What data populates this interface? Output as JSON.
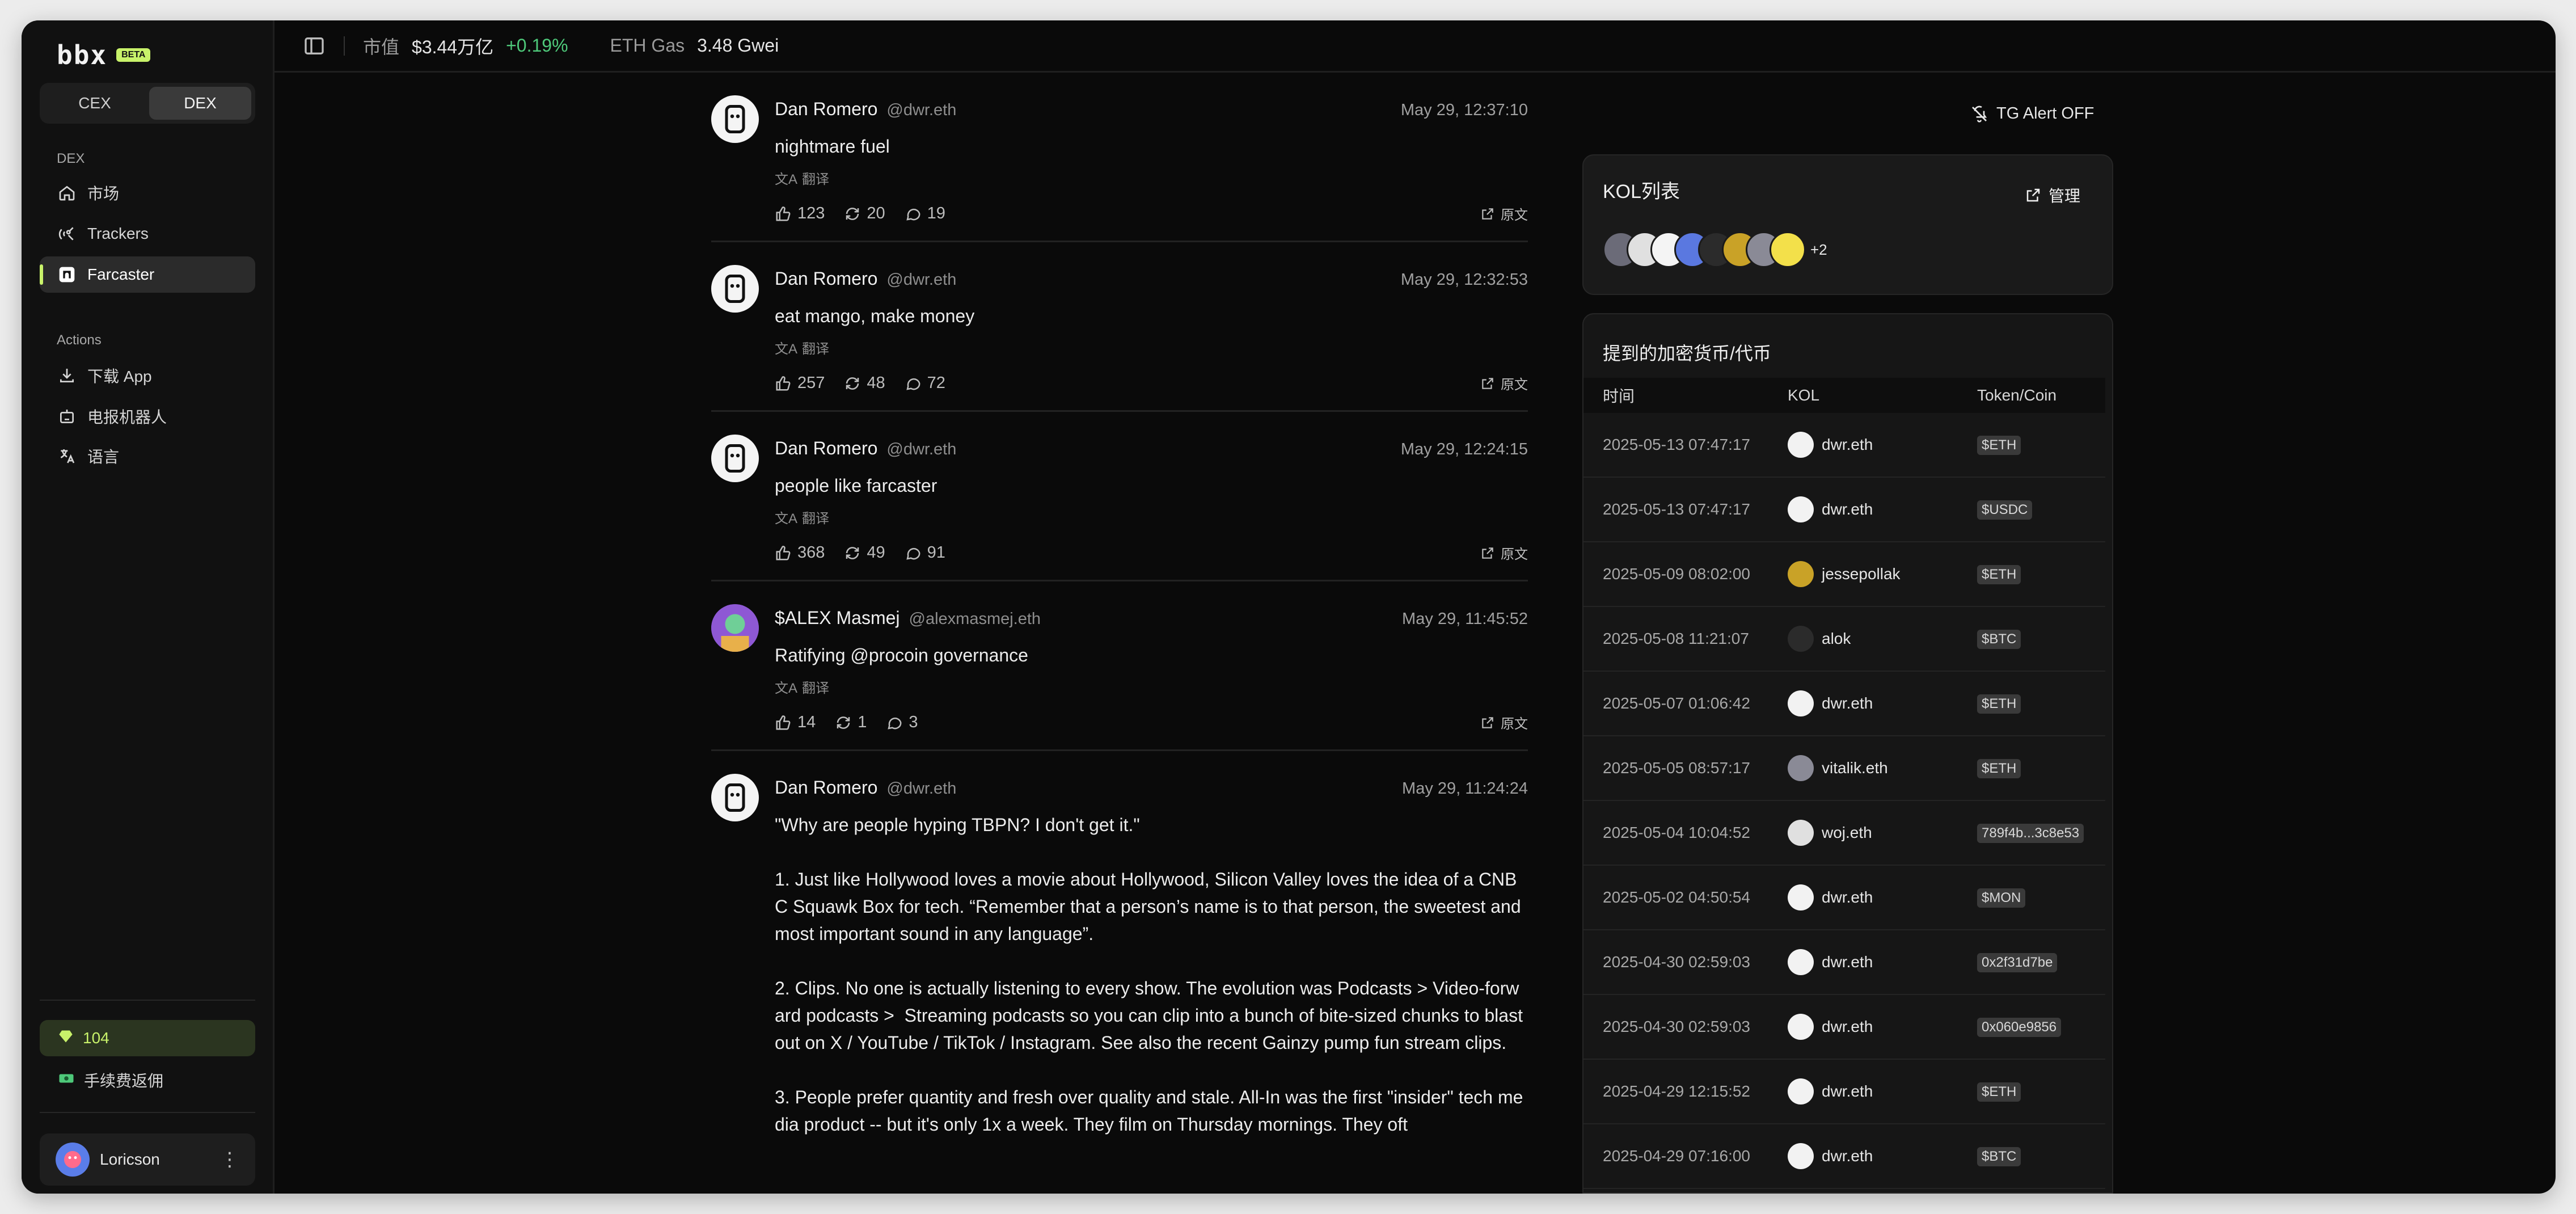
{
  "brand": {
    "logo": "bbx",
    "badge": "BETA"
  },
  "segment": {
    "cex": "CEX",
    "dex": "DEX"
  },
  "sidebar": {
    "dex_label": "DEX",
    "items": [
      {
        "label": "市场",
        "icon": "home-icon"
      },
      {
        "label": "Trackers",
        "icon": "satellite-icon"
      },
      {
        "label": "Farcaster",
        "icon": "farcaster-icon"
      }
    ],
    "actions_label": "Actions",
    "actions": [
      {
        "label": "下载 App",
        "icon": "download-icon"
      },
      {
        "label": "电报机器人",
        "icon": "bot-icon"
      },
      {
        "label": "语言",
        "icon": "translate-icon"
      }
    ],
    "points": "104",
    "rebate": "手续费返佣",
    "user": "Loricson"
  },
  "topbar": {
    "mcap_label": "市值",
    "mcap_value": "$3.44万亿",
    "mcap_change": "+0.19%",
    "gas_label": "ETH Gas",
    "gas_value": "3.48 Gwei"
  },
  "feed": {
    "translate": "翻译",
    "source": "原文",
    "posts": [
      {
        "name": "Dan Romero",
        "handle": "@dwr.eth",
        "time": "May 29, 12:37:10",
        "text": "nightmare fuel",
        "likes": "123",
        "recasts": "20",
        "replies": "19"
      },
      {
        "name": "Dan Romero",
        "handle": "@dwr.eth",
        "time": "May 29, 12:32:53",
        "text": "eat mango, make money",
        "likes": "257",
        "recasts": "48",
        "replies": "72"
      },
      {
        "name": "Dan Romero",
        "handle": "@dwr.eth",
        "time": "May 29, 12:24:15",
        "text": "people like farcaster",
        "likes": "368",
        "recasts": "49",
        "replies": "91"
      },
      {
        "name": "$ALEX Masmej",
        "handle": "@alexmasmej.eth",
        "time": "May 29, 11:45:52",
        "text": "Ratifying @procoin governance",
        "likes": "14",
        "recasts": "1",
        "replies": "3"
      },
      {
        "name": "Dan Romero",
        "handle": "@dwr.eth",
        "time": "May 29, 11:24:24",
        "text": "\"Why are people hyping TBPN? I don't get it.\"\n\n1. Just like Hollywood loves a movie about Hollywood, Silicon Valley loves the idea of a CNBC Squawk Box for tech. “Remember that a person’s name is to that person, the sweetest and most important sound in any language”.\n\n2. Clips. No one is actually listening to every show. The evolution was Podcasts > Video-forward podcasts >  Streaming podcasts so you can clip into a bunch of bite-sized chunks to blast out on X / YouTube / TikTok / Instagram. See also the recent Gainzy pump fun stream clips.\n\n3. People prefer quantity and fresh over quality and stale. All-In was the first \"insider\" tech media product -- but it's only 1x a week. They film on Thursday mornings. They oft",
        "likes": "",
        "recasts": "",
        "replies": ""
      }
    ]
  },
  "right": {
    "tg_alert": "TG Alert OFF",
    "kol_title": "KOL列表",
    "manage": "管理",
    "kol_more": "+2",
    "coin_title": "提到的加密货币/代币",
    "headers": {
      "time": "时间",
      "kol": "KOL",
      "token": "Token/Coin"
    },
    "rows": [
      {
        "time": "2025-05-13 07:47:17",
        "kol": "dwr.eth",
        "token": "$ETH"
      },
      {
        "time": "2025-05-13 07:47:17",
        "kol": "dwr.eth",
        "token": "$USDC"
      },
      {
        "time": "2025-05-09 08:02:00",
        "kol": "jessepollak",
        "token": "$ETH"
      },
      {
        "time": "2025-05-08 11:21:07",
        "kol": "alok",
        "token": "$BTC"
      },
      {
        "time": "2025-05-07 01:06:42",
        "kol": "dwr.eth",
        "token": "$ETH"
      },
      {
        "time": "2025-05-05 08:57:17",
        "kol": "vitalik.eth",
        "token": "$ETH"
      },
      {
        "time": "2025-05-04 10:04:52",
        "kol": "woj.eth",
        "token": "789f4b...3c8e53"
      },
      {
        "time": "2025-05-02 04:50:54",
        "kol": "dwr.eth",
        "token": "$MON"
      },
      {
        "time": "2025-04-30 02:59:03",
        "kol": "dwr.eth",
        "token": "0x2f31d7be"
      },
      {
        "time": "2025-04-30 02:59:03",
        "kol": "dwr.eth",
        "token": "0x060e9856"
      },
      {
        "time": "2025-04-29 12:15:52",
        "kol": "dwr.eth",
        "token": "$ETH"
      },
      {
        "time": "2025-04-29 07:16:00",
        "kol": "dwr.eth",
        "token": "$BTC"
      }
    ]
  },
  "colors": {
    "accent": "#c8f26a",
    "positive": "#4ec97a",
    "background": "#0a0a0a"
  }
}
